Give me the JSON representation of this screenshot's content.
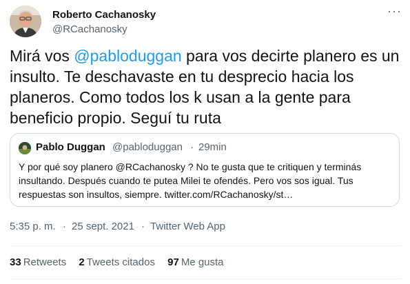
{
  "author": {
    "display_name": "Roberto Cachanosky",
    "handle": "@RCachanosky",
    "avatar_icon": "profile-photo"
  },
  "more_icon": "more-options-icon",
  "tweet": {
    "text_before": "Mirá vos ",
    "mention": "@pabloduggan",
    "text_after": " para vos decirte planero es un insulto. Te deschavaste en tu desprecio hacia los planeros. Como todos los k usan a la gente para beneficio propio. Seguí tu ruta"
  },
  "quoted_tweet": {
    "display_name": "Pablo Duggan",
    "handle": "@pabloduggan",
    "separator": "·",
    "time": "29min",
    "text": "Y por qué soy planero @RCachanosky ? No te gusta que te critiquen y terminás insultando. Después cuando te putea Milei te ofendés. Pero vos sos igual. Tus respuestas son insultos, siempre. twitter.com/RCachanosky/st…"
  },
  "meta": {
    "time": "5:35 p. m.",
    "separator1": "·",
    "date": "25 sept. 2021",
    "separator2": "·",
    "source": "Twitter Web App"
  },
  "stats": [
    {
      "count": "33",
      "label": "Retweets"
    },
    {
      "count": "2",
      "label": "Tweets citados"
    },
    {
      "count": "97",
      "label": "Me gusta"
    }
  ],
  "colors": {
    "accent": "#1d9bf0",
    "text": "#0f1419",
    "secondary": "#536471",
    "border": "#cfd9de"
  }
}
